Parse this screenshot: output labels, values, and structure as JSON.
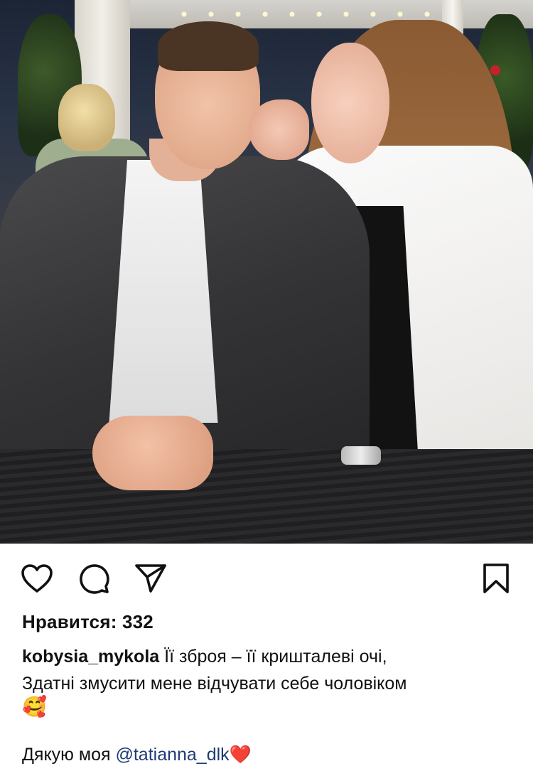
{
  "post": {
    "likes_text": "Нравится: 332",
    "caption": {
      "username": "kobysia_mykola",
      "line1": "Її зброя – її кришталеві очі,",
      "line2": "Здатні змусити мене відчувати себе чоловіком",
      "emoji": "🥰"
    },
    "thanks": {
      "prefix": "Дякую моя ",
      "mention": "@tatianna_dlk",
      "heart": "❤️"
    }
  },
  "actions": {
    "like_icon": "heart-outline-icon",
    "comment_icon": "comment-bubble-icon",
    "share_icon": "paper-plane-icon",
    "save_icon": "bookmark-icon"
  },
  "colors": {
    "text": "#111111",
    "mention": "#1f3b73",
    "heart": "#e0202e",
    "background": "#ffffff"
  }
}
